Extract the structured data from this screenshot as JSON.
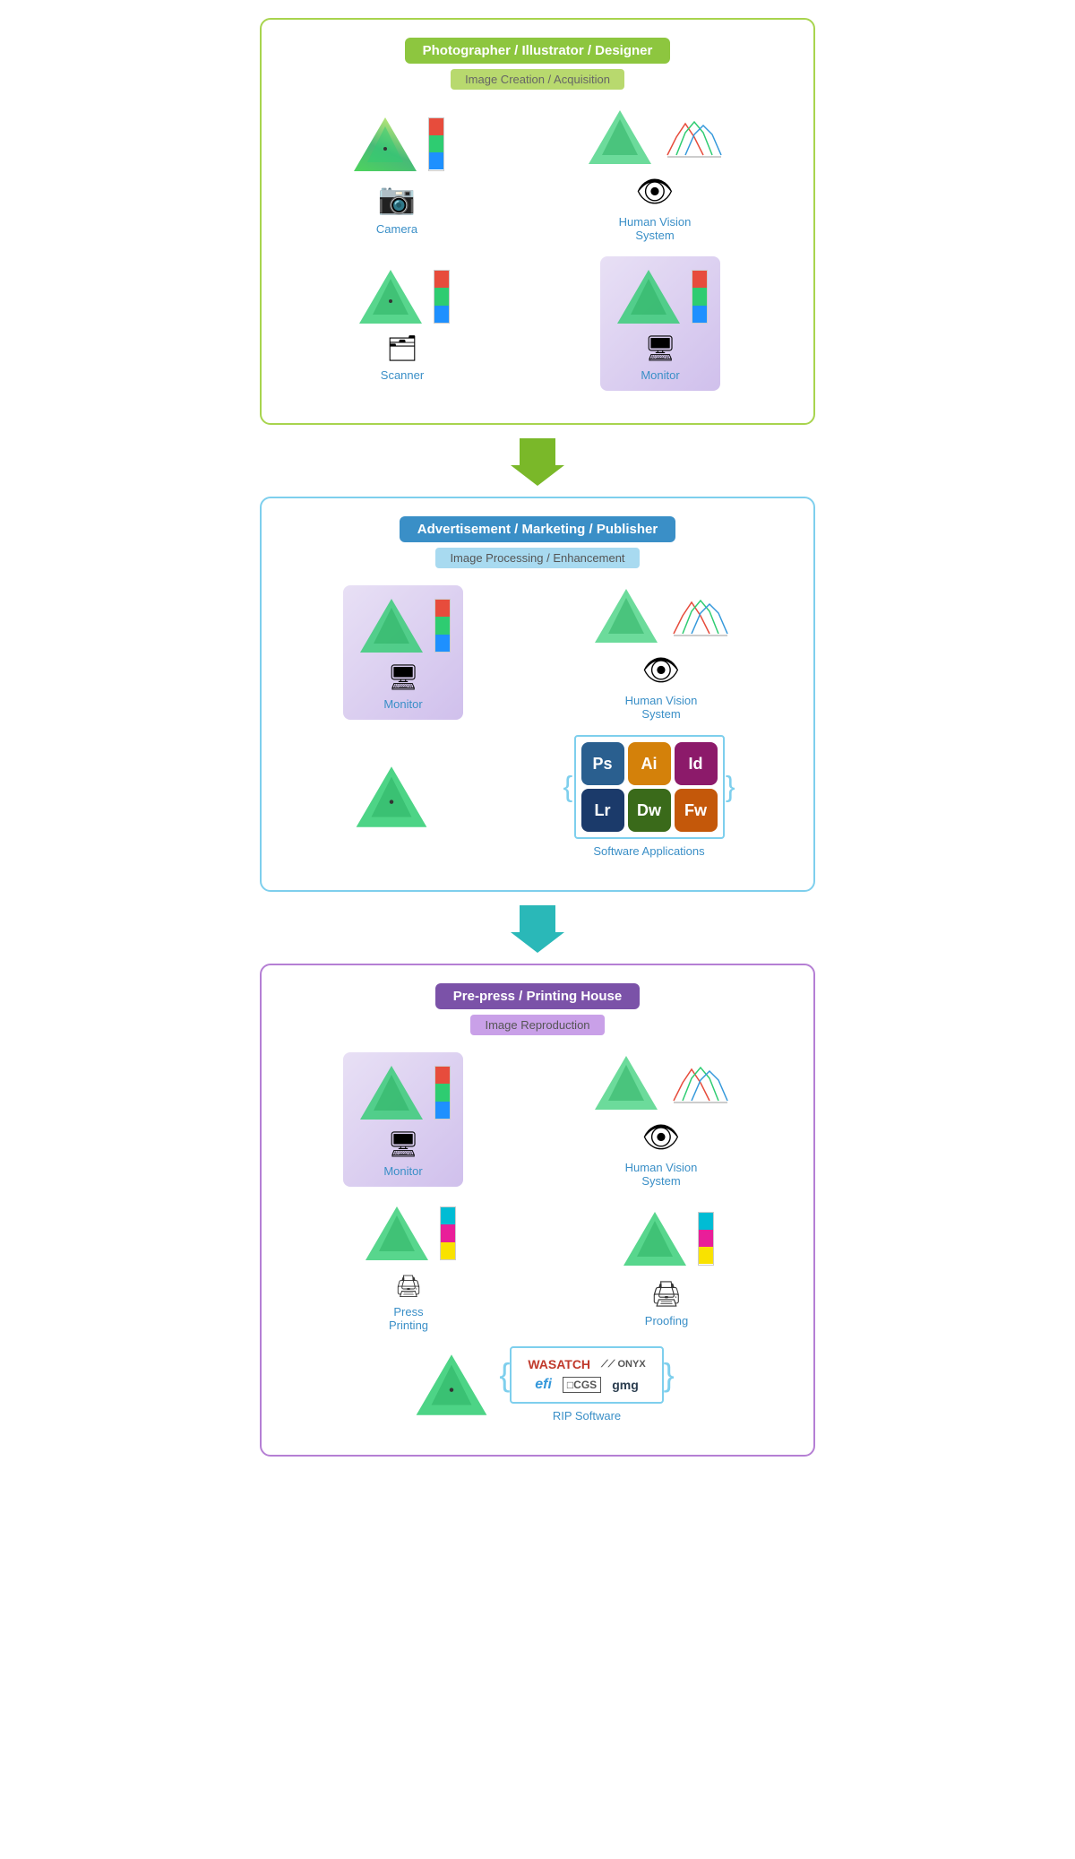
{
  "sections": [
    {
      "id": "section1",
      "title": "Photographer / Illustrator / Designer",
      "subtitle": "Image Creation / Acquisition",
      "titleColor": "green-bg",
      "subtitleColor": "green-light",
      "borderColor": "green-border"
    },
    {
      "id": "section2",
      "title": "Advertisement / Marketing / Publisher",
      "subtitle": "Image Processing / Enhancement",
      "titleColor": "blue-bg",
      "subtitleColor": "blue-light",
      "borderColor": "blue-border"
    },
    {
      "id": "section3",
      "title": "Pre-press / Printing House",
      "subtitle": "Image Reproduction",
      "titleColor": "purple-bg",
      "subtitleColor": "purple-light",
      "borderColor": "purple-border"
    }
  ],
  "devices": {
    "camera": "Camera",
    "humanVision": "Human Vision\nSystem",
    "scanner": "Scanner",
    "monitor": "Monitor",
    "pressRolls": "Press\nPrinting",
    "proofing": "Proofing",
    "softwareApps": "Software Applications",
    "ripSoftware": "RIP Software"
  },
  "apps": [
    {
      "label": "Ps",
      "class": "app-ps"
    },
    {
      "label": "Ai",
      "class": "app-ai"
    },
    {
      "label": "Id",
      "class": "app-id"
    },
    {
      "label": "Lr",
      "class": "app-lr"
    },
    {
      "label": "Dw",
      "class": "app-dw"
    },
    {
      "label": "Fw",
      "class": "app-fw"
    }
  ],
  "rip": {
    "wasatch": "WASATCH",
    "onyx": "// ONYX",
    "efi": "efi",
    "cgs": "□CGS",
    "gmg": "gmg"
  },
  "arrows": {
    "greenArrow": "#7ab829",
    "tealArrow": "#2ab8b8"
  }
}
